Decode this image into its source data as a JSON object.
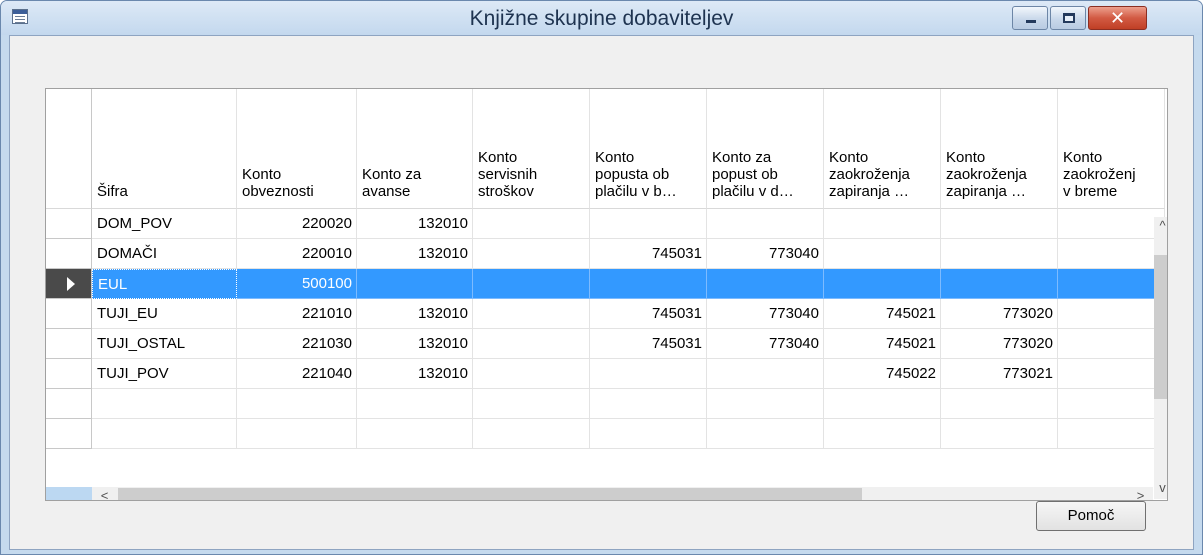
{
  "window": {
    "title": "Knjižne skupine dobaviteljev",
    "close_glyph": "✕"
  },
  "grid": {
    "columns": [
      {
        "key": "sifra",
        "label": "Šifra",
        "align": "left"
      },
      {
        "key": "konto_obveznosti",
        "label": "Konto\nobveznosti",
        "align": "right"
      },
      {
        "key": "konto_za_avanse",
        "label": "Konto za\navanse",
        "align": "right"
      },
      {
        "key": "konto_servisnih_stroskov",
        "label": "Konto\nservisnih\nstroškov",
        "align": "right"
      },
      {
        "key": "konto_popusta_b",
        "label": "Konto\npopusta ob\nplačilu v b…",
        "align": "right"
      },
      {
        "key": "konto_popust_d",
        "label": "Konto za\npopust ob\nplačilu v d…",
        "align": "right"
      },
      {
        "key": "konto_zaokrozenja_1",
        "label": "Konto\nzaokroženja\nzapiranja …",
        "align": "right"
      },
      {
        "key": "konto_zaokrozenja_2",
        "label": "Konto\nzaokroženja\nzapiranja …",
        "align": "right"
      },
      {
        "key": "konto_zaokrozenj_breme",
        "label": "Konto\nzaokroženj\nv breme",
        "align": "right"
      }
    ],
    "rows": [
      [
        "DOM_POV",
        "220020",
        "132010",
        "",
        "",
        "",
        "",
        "",
        ""
      ],
      [
        "DOMAČI",
        "220010",
        "132010",
        "",
        "745031",
        "773040",
        "",
        "",
        ""
      ],
      [
        "EUL",
        "500100",
        "",
        "",
        "",
        "",
        "",
        "",
        ""
      ],
      [
        "TUJI_EU",
        "221010",
        "132010",
        "",
        "745031",
        "773040",
        "745021",
        "773020",
        ""
      ],
      [
        "TUJI_OSTAL",
        "221030",
        "132010",
        "",
        "745031",
        "773040",
        "745021",
        "773020",
        ""
      ],
      [
        "TUJI_POV",
        "221040",
        "132010",
        "",
        "",
        "",
        "745022",
        "773021",
        ""
      ],
      [
        "",
        "",
        "",
        "",
        "",
        "",
        "",
        "",
        ""
      ],
      [
        "",
        "",
        "",
        "",
        "",
        "",
        "",
        "",
        ""
      ]
    ],
    "selected_row": 2
  },
  "scroll": {
    "up": "^",
    "down": "v",
    "left": "<",
    "right": ">"
  },
  "buttons": {
    "help": "Pomoč"
  },
  "colors": {
    "selection": "#3399ff",
    "title_bar": "#c5daee"
  }
}
